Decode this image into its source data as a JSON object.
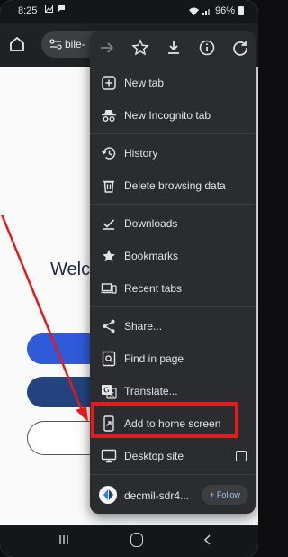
{
  "status_bar": {
    "time": "8:25",
    "battery": "96%"
  },
  "toolbar": {
    "url_fragment": "bile-"
  },
  "page": {
    "welcome": "Welc"
  },
  "menu": {
    "items": [
      {
        "label": "New tab",
        "icon": "plus-box-icon"
      },
      {
        "label": "New Incognito tab",
        "icon": "incognito-icon"
      },
      {
        "label": "History",
        "icon": "history-icon"
      },
      {
        "label": "Delete browsing data",
        "icon": "trash-icon"
      },
      {
        "label": "Downloads",
        "icon": "download-check-icon"
      },
      {
        "label": "Bookmarks",
        "icon": "star-filled-icon"
      },
      {
        "label": "Recent tabs",
        "icon": "devices-icon"
      },
      {
        "label": "Share...",
        "icon": "share-icon"
      },
      {
        "label": "Find in page",
        "icon": "find-page-icon"
      },
      {
        "label": "Translate...",
        "icon": "translate-icon"
      },
      {
        "label": "Add to home screen",
        "icon": "add-home-icon"
      },
      {
        "label": "Desktop site",
        "icon": "monitor-icon"
      }
    ],
    "follow_site": "decmil-sdr4...",
    "follow_button": "+ Follow"
  },
  "colors": {
    "menu_bg": "#2b2c2f",
    "highlight": "#e21b1b",
    "page_button_primary": "#2f5bd8",
    "page_button_secondary": "#24437e",
    "follow_text": "#a8c7fa"
  }
}
